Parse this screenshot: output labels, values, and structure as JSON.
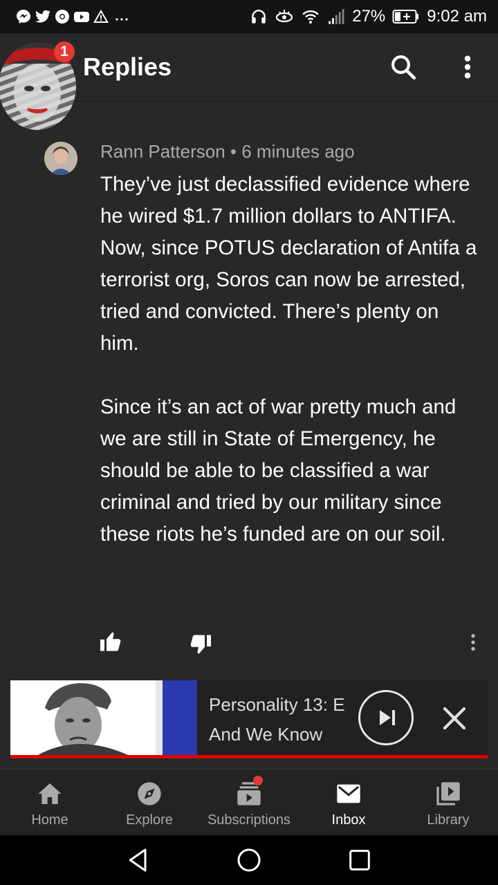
{
  "status_bar": {
    "battery": "27%",
    "time": "9:02 am"
  },
  "header": {
    "title": "Replies",
    "notification_count": "1"
  },
  "comment": {
    "author": "Rann Patterson",
    "separator": "•",
    "time": "6 minutes ago",
    "paragraphs": [
      "They’ve just declassified evidence where he wired $1.7 million dollars to ANTIFA.",
      "Now, since POTUS declaration of Antifa a terrorist org, Soros can now be arrested, tried and convicted. There’s plenty on him.",
      "Since it’s an act of war pretty much and we are still in State of Emergency, he should be able to be classified a war criminal and tried by our military since these riots he’s funded are on our soil."
    ]
  },
  "mini_player": {
    "title": "Personality 13: E",
    "subtitle": "And We Know",
    "progress": 1.0
  },
  "bottom_nav": {
    "items": [
      {
        "label": "Home",
        "icon": "home-icon",
        "active": false
      },
      {
        "label": "Explore",
        "icon": "compass-icon",
        "active": false
      },
      {
        "label": "Subscriptions",
        "icon": "subscriptions-icon",
        "active": false
      },
      {
        "label": "Inbox",
        "icon": "mail-icon",
        "active": true
      },
      {
        "label": "Library",
        "icon": "library-icon",
        "active": false
      }
    ]
  },
  "colors": {
    "background": "#282828",
    "accent_red": "#e53935",
    "progress_red": "#e00000",
    "muted_text": "#aaaaaa"
  }
}
